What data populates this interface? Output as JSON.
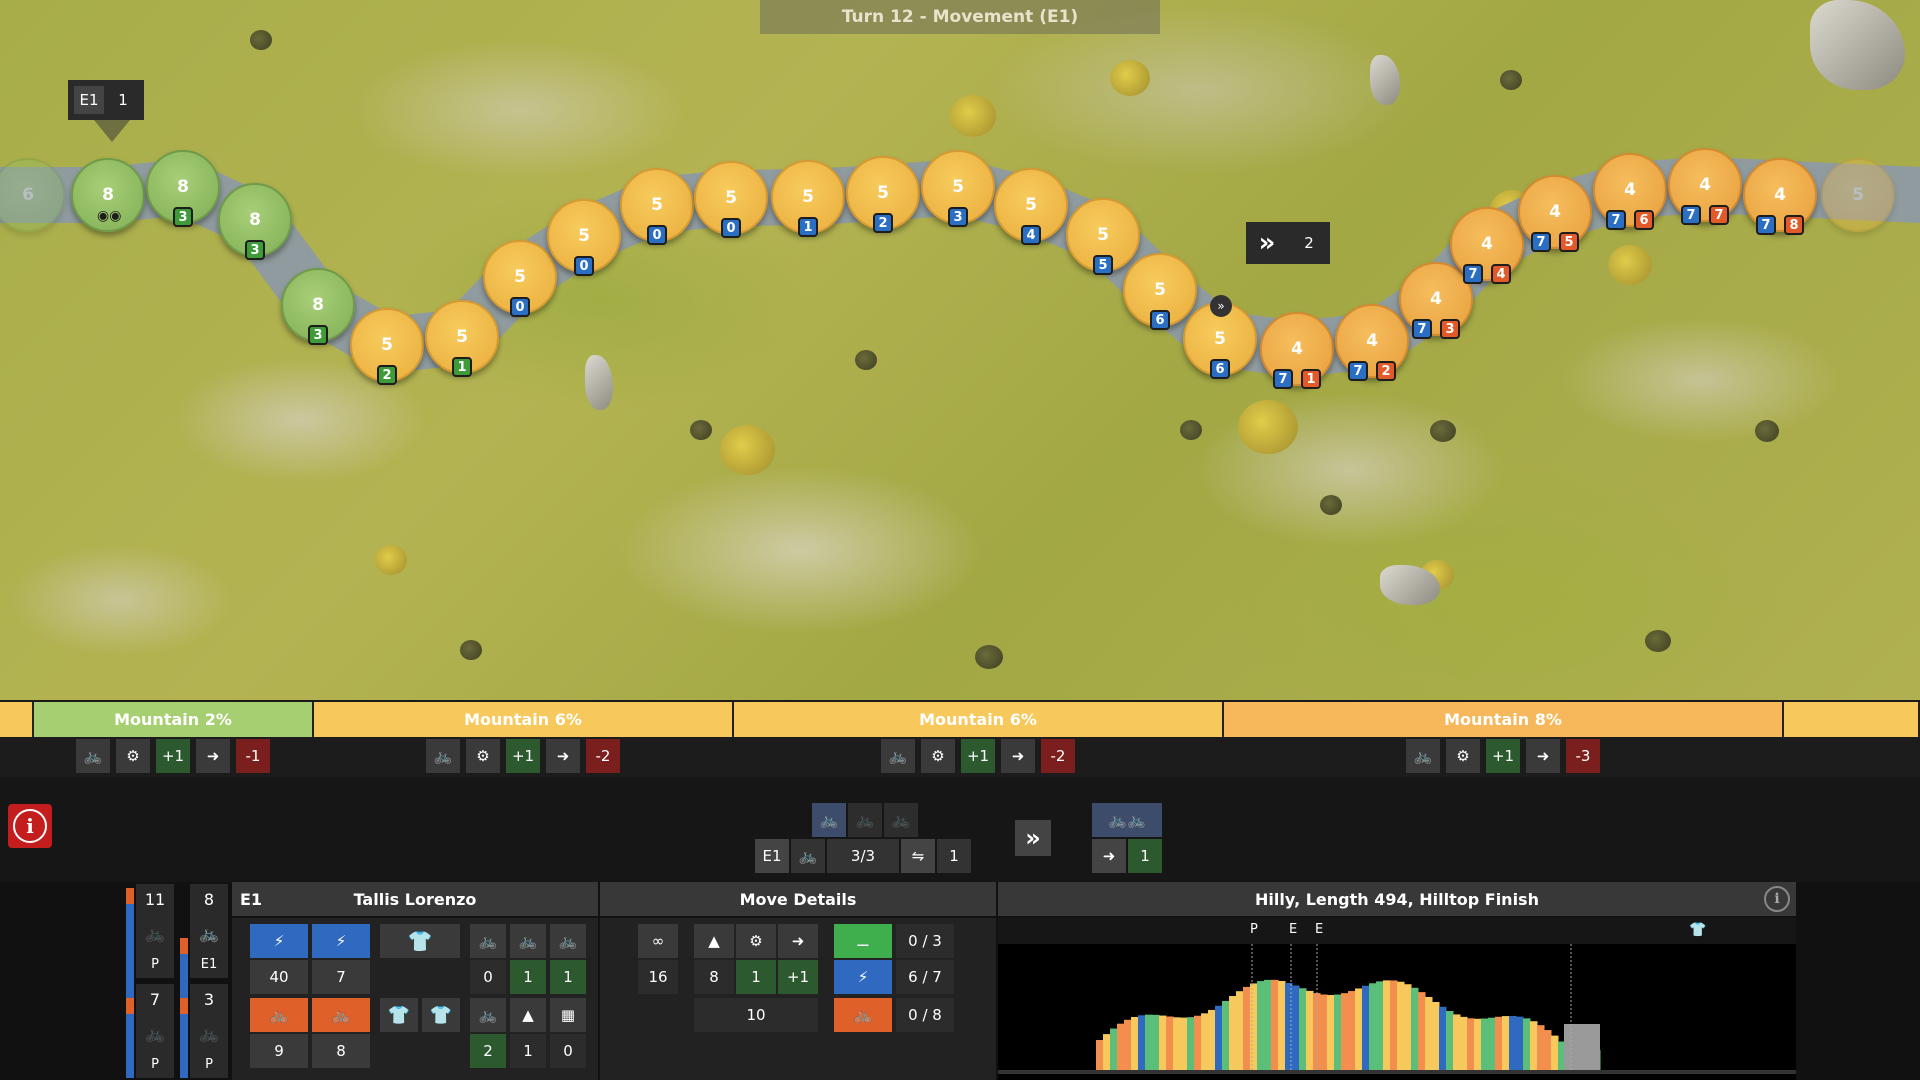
{
  "turn_banner": "Turn 12 - Movement (E1)",
  "rider_label": {
    "team": "E1",
    "count": "1"
  },
  "move_tip": {
    "icon": "fast-forward-icon",
    "value": "2"
  },
  "tiles": [
    {
      "v": "6",
      "c": "green",
      "faded": true,
      "badges": []
    },
    {
      "v": "8",
      "c": "green",
      "badges": []
    },
    {
      "v": "8",
      "c": "green",
      "badges": [
        {
          "t": "3",
          "k": "g"
        }
      ]
    },
    {
      "v": "8",
      "c": "green",
      "badges": [
        {
          "t": "3",
          "k": "g"
        }
      ]
    },
    {
      "v": "8",
      "c": "green",
      "badges": [
        {
          "t": "3",
          "k": "g"
        }
      ]
    },
    {
      "v": "5",
      "c": "y6",
      "badges": [
        {
          "t": "2",
          "k": "g"
        }
      ]
    },
    {
      "v": "5",
      "c": "y6",
      "badges": [
        {
          "t": "1",
          "k": "g"
        }
      ]
    },
    {
      "v": "5",
      "c": "y6",
      "badges": [
        {
          "t": "0",
          "k": "b"
        }
      ]
    },
    {
      "v": "5",
      "c": "y6",
      "badges": [
        {
          "t": "0",
          "k": "b"
        }
      ]
    },
    {
      "v": "5",
      "c": "y6",
      "badges": [
        {
          "t": "0",
          "k": "b"
        }
      ]
    },
    {
      "v": "5",
      "c": "y6",
      "badges": [
        {
          "t": "0",
          "k": "b"
        }
      ]
    },
    {
      "v": "5",
      "c": "y6",
      "badges": [
        {
          "t": "1",
          "k": "b"
        }
      ]
    },
    {
      "v": "5",
      "c": "y6",
      "badges": [
        {
          "t": "2",
          "k": "b"
        }
      ]
    },
    {
      "v": "5",
      "c": "y6",
      "badges": [
        {
          "t": "3",
          "k": "b"
        }
      ]
    },
    {
      "v": "5",
      "c": "y6",
      "badges": [
        {
          "t": "4",
          "k": "b"
        }
      ]
    },
    {
      "v": "5",
      "c": "y6",
      "badges": [
        {
          "t": "5",
          "k": "b"
        }
      ]
    },
    {
      "v": "5",
      "c": "y6",
      "badges": [
        {
          "t": "6",
          "k": "b"
        }
      ]
    },
    {
      "v": "5",
      "c": "y6",
      "badges": [
        {
          "t": "6",
          "k": "b"
        }
      ]
    },
    {
      "v": "4",
      "c": "y8",
      "badges": [
        {
          "t": "7",
          "k": "b"
        },
        {
          "t": "1",
          "k": "o"
        }
      ]
    },
    {
      "v": "4",
      "c": "y8",
      "badges": [
        {
          "t": "7",
          "k": "b"
        },
        {
          "t": "2",
          "k": "o"
        }
      ]
    },
    {
      "v": "4",
      "c": "y8",
      "badges": [
        {
          "t": "7",
          "k": "b"
        },
        {
          "t": "3",
          "k": "o"
        }
      ]
    },
    {
      "v": "4",
      "c": "y8",
      "badges": [
        {
          "t": "7",
          "k": "b"
        },
        {
          "t": "4",
          "k": "o"
        }
      ]
    },
    {
      "v": "4",
      "c": "y8",
      "badges": [
        {
          "t": "7",
          "k": "b"
        },
        {
          "t": "5",
          "k": "o"
        }
      ]
    },
    {
      "v": "4",
      "c": "y8",
      "badges": [
        {
          "t": "7",
          "k": "b"
        },
        {
          "t": "6",
          "k": "o"
        }
      ]
    },
    {
      "v": "4",
      "c": "y8",
      "badges": [
        {
          "t": "7",
          "k": "b"
        },
        {
          "t": "7",
          "k": "o"
        }
      ]
    },
    {
      "v": "4",
      "c": "y8",
      "badges": [
        {
          "t": "7",
          "k": "b"
        },
        {
          "t": "8",
          "k": "o"
        }
      ]
    },
    {
      "v": "5",
      "c": "y6",
      "faded": true,
      "badges": []
    }
  ],
  "segments": [
    {
      "label": "",
      "color": "#f7c95c"
    },
    {
      "label": "Mountain 2%",
      "color": "#a6cf72"
    },
    {
      "label": "Mountain 6%",
      "color": "#f7c95c"
    },
    {
      "label": "Mountain 6%",
      "color": "#f7c95c"
    },
    {
      "label": "Mountain 8%",
      "color": "#f6b85a"
    },
    {
      "label": "",
      "color": "#f7c95c"
    }
  ],
  "segment_mods": [
    {
      "bonus": "+1",
      "penalty": "-1"
    },
    {
      "bonus": "+1",
      "penalty": "-2"
    },
    {
      "bonus": "+1",
      "penalty": "-2"
    },
    {
      "bonus": "+1",
      "penalty": "-3"
    }
  ],
  "move_bar": {
    "team": "E1",
    "riders": "3/3",
    "lanes": "1",
    "slipstream": "1"
  },
  "roster": [
    {
      "num": "11",
      "tag": "P"
    },
    {
      "num": "8",
      "tag": "E1"
    },
    {
      "num": "7",
      "tag": "P"
    },
    {
      "num": "3",
      "tag": "P"
    }
  ],
  "rider_panel": {
    "team": "E1",
    "name": "Tallis Lorenzo",
    "sprint": "40",
    "sprint_max": "7",
    "endurance": "9",
    "endurance_max": "8",
    "cards_a": [
      "0",
      "1",
      "1"
    ],
    "cards_b": [
      "2",
      "1",
      "0"
    ]
  },
  "move_details": {
    "title": "Move Details",
    "distance": "16",
    "mountain": "8",
    "gear": "1",
    "draft": "+1",
    "total": "10",
    "rest": "0 / 3",
    "sprint": "6 / 7",
    "endurance": "0 / 8"
  },
  "course": {
    "title": "Hilly, Length 494, Hilltop Finish",
    "markers": [
      "P",
      "E",
      "E"
    ]
  },
  "colors": {
    "green_tile": "#8fbd62",
    "yellow_tile": "#f2bb4c",
    "badge_blue": "#2a6fc4",
    "badge_orange": "#e2592a",
    "badge_green": "#3f9a3a",
    "info_red": "#c41d1d"
  }
}
